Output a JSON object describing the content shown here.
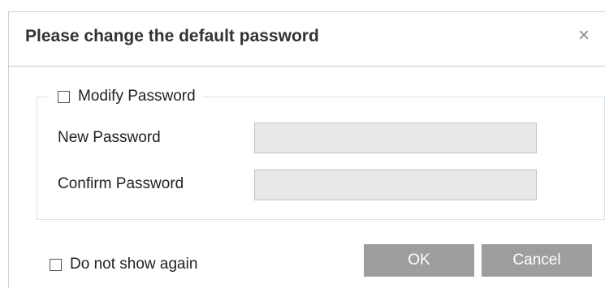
{
  "dialog": {
    "title": "Please change the default password",
    "close_glyph": "×",
    "modify_label": "Modify Password",
    "new_password_label": "New Password",
    "new_password_value": "",
    "confirm_password_label": "Confirm Password",
    "confirm_password_value": "",
    "dont_show_label": "Do not show again",
    "ok_label": "OK",
    "cancel_label": "Cancel"
  },
  "icons": {
    "close": "close-icon"
  },
  "colors": {
    "button_bg": "#9e9e9e",
    "input_bg": "#e8e8e8",
    "group_border": "#d6e4ee"
  }
}
